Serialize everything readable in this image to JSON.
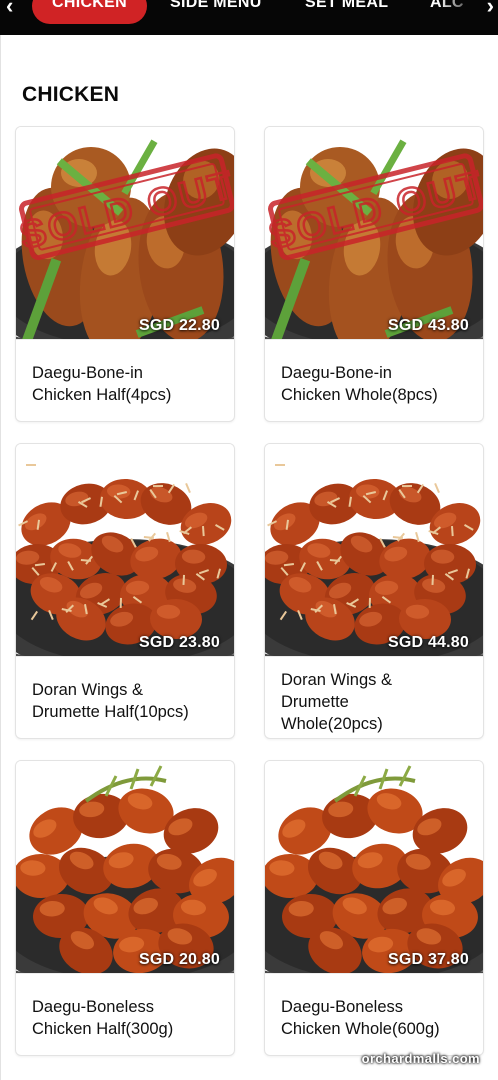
{
  "nav": {
    "left_arrow": "‹",
    "right_arrow": "›",
    "tabs": [
      {
        "label": "CHICKEN",
        "active": true
      },
      {
        "label": "SIDE MENU",
        "active": false
      },
      {
        "label": "SET MEAL",
        "active": false
      },
      {
        "label": "ALC",
        "active": false
      }
    ]
  },
  "section": {
    "title": "CHICKEN"
  },
  "items": [
    {
      "name_line1": "Daegu-Bone-in",
      "name_line2": "Chicken Half(4pcs)",
      "name_line3": "",
      "price": "SGD 22.80",
      "sold_out": true,
      "sold_out_text": "SOLD OUT",
      "image": "bone-in-chicken-image"
    },
    {
      "name_line1": "Daegu-Bone-in",
      "name_line2": "Chicken Whole(8pcs)",
      "name_line3": "",
      "price": "SGD 43.80",
      "sold_out": true,
      "sold_out_text": "SOLD OUT",
      "image": "bone-in-chicken-image"
    },
    {
      "name_line1": "Doran Wings &",
      "name_line2": "Drumette Half(10pcs)",
      "name_line3": "",
      "price": "SGD 23.80",
      "sold_out": false,
      "image": "wings-image"
    },
    {
      "name_line1": "Doran Wings &",
      "name_line2": "Drumette",
      "name_line3": "Whole(20pcs)",
      "price": "SGD 44.80",
      "sold_out": false,
      "image": "wings-image"
    },
    {
      "name_line1": "Daegu-Boneless",
      "name_line2": "Chicken Half(300g)",
      "name_line3": "",
      "price": "SGD 20.80",
      "sold_out": false,
      "image": "boneless-chicken-image"
    },
    {
      "name_line1": "Daegu-Boneless",
      "name_line2": "Chicken Whole(600g)",
      "name_line3": "",
      "price": "SGD 37.80",
      "sold_out": false,
      "image": "boneless-chicken-image"
    }
  ],
  "colors": {
    "accent": "#d02325",
    "topbar": "#060606",
    "sold_out_stamp": "#c8242a"
  },
  "watermark": "orchardmalls.com"
}
